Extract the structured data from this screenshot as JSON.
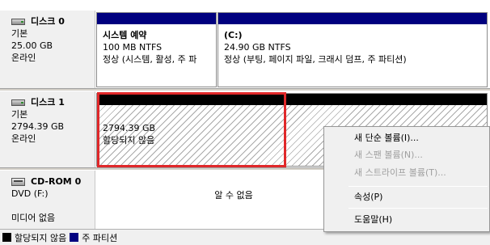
{
  "disks": [
    {
      "name": "디스크 0",
      "type": "기본",
      "size": "25.00 GB",
      "status": "온라인",
      "icon": "hard-disk-icon"
    },
    {
      "name": "디스크 1",
      "type": "기본",
      "size": "2794.39 GB",
      "status": "온라인",
      "icon": "hard-disk-icon"
    },
    {
      "name": "CD-ROM 0",
      "type": "DVD (F:)",
      "size": "",
      "status": "미디어 없음",
      "icon": "cd-drive-icon"
    }
  ],
  "disk0_partitions": [
    {
      "name": "시스템 예약",
      "size_fs": "100 MB NTFS",
      "status": "정상 (시스템, 활성, 주 파"
    },
    {
      "name": "(C:)",
      "size_fs": "24.90 GB NTFS",
      "status": "정상 (부팅, 페이지 파일, 크래시 덤프, 주 파티션)"
    }
  ],
  "disk1_unallocated": {
    "size": "2794.39 GB",
    "label": "할당되지 않음"
  },
  "cdrom_content": "알 수 없음",
  "context_menu": {
    "items": [
      {
        "label": "새 단순 볼륨(I)...",
        "enabled": true
      },
      {
        "label": "새 스팬 볼륨(N)...",
        "enabled": false
      },
      {
        "label": "새 스트라이프 볼륨(T)...",
        "enabled": false
      },
      {
        "label": "속성(P)",
        "enabled": true
      },
      {
        "label": "도움말(H)",
        "enabled": true
      }
    ]
  },
  "legend": [
    {
      "label": "할당되지 않음",
      "color": "#000000"
    },
    {
      "label": "주 파티션",
      "color": "#00007f"
    }
  ],
  "colors": {
    "primary_partition_bar": "#00007f",
    "unallocated_bar": "#000000",
    "highlight_border": "#e0282a"
  }
}
